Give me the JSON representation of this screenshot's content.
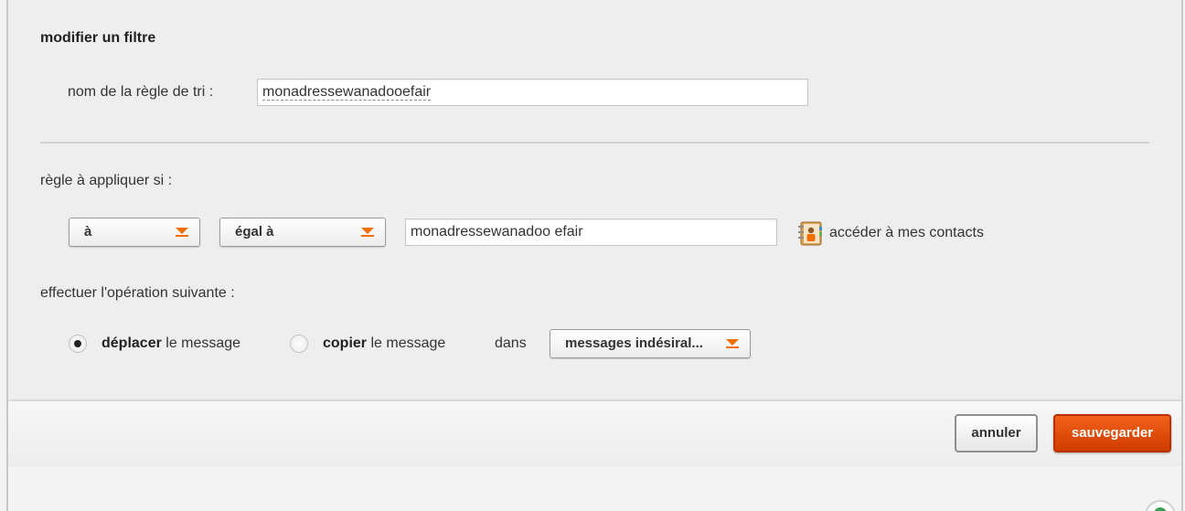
{
  "form": {
    "title": "modifier un filtre",
    "rule_name_label": "nom de la règle de tri :",
    "rule_name_value": "monadressewanadooefair",
    "condition_label": "règle à appliquer si :",
    "field_select": "à",
    "operator_select": "égal à",
    "condition_value": "monadressewanadoo efair",
    "contacts_link": "accéder à mes contacts",
    "action_label": "effectuer l'opération suivante :",
    "move_bold": "déplacer",
    "move_rest": " le message",
    "copy_bold": "copier",
    "copy_rest": " le message",
    "in_label": "dans",
    "folder_select": "messages indésiral...",
    "selected_action": "déplacer"
  },
  "buttons": {
    "cancel": "annuler",
    "save": "sauvegarder"
  },
  "colors": {
    "accent": "#f16e00",
    "save_button": "#e04a00"
  },
  "icons": {
    "contacts": "address-book-icon",
    "dropdown": "chevron-down-icon"
  }
}
